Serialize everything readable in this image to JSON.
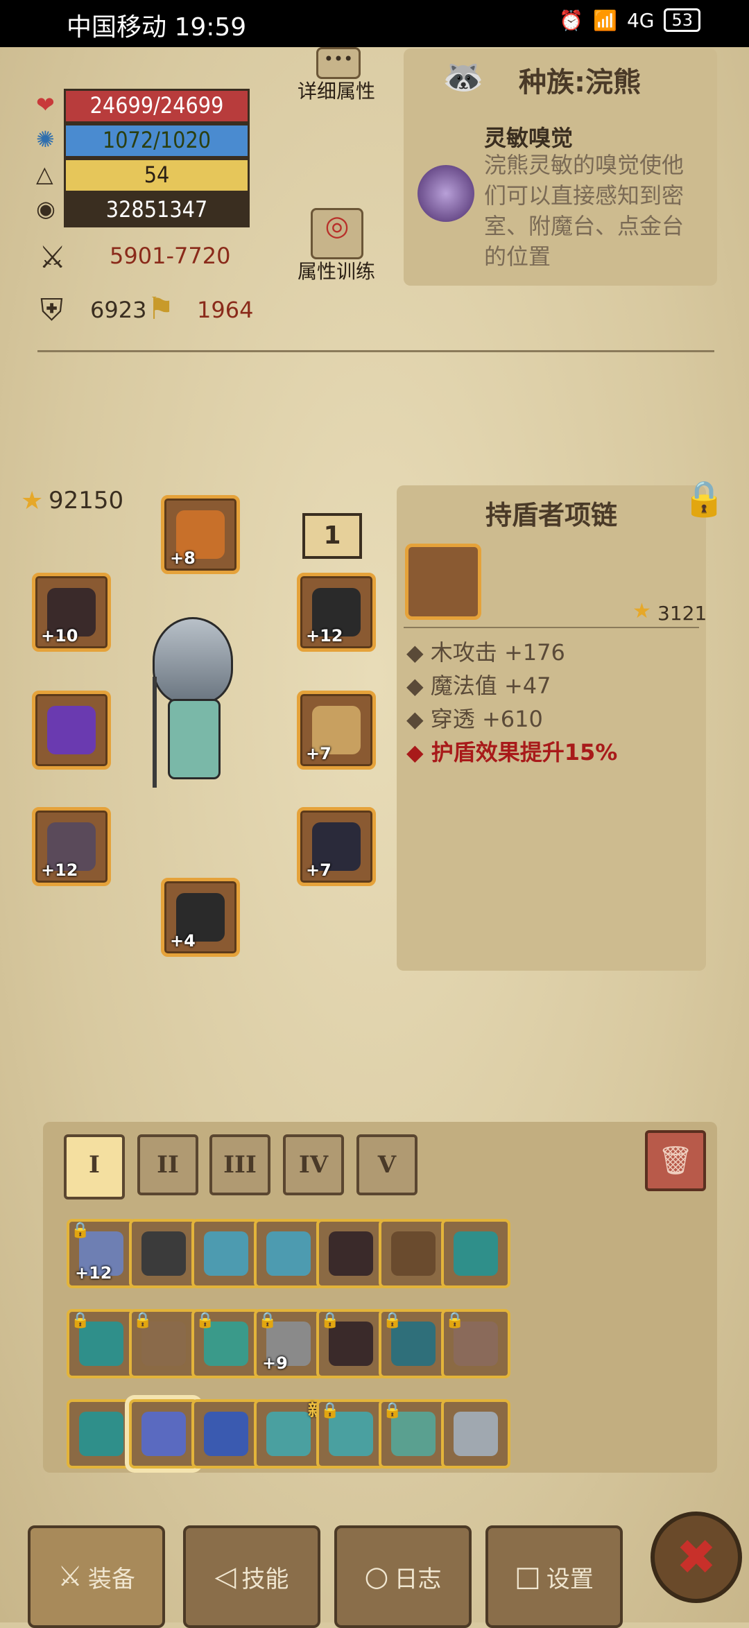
{
  "status_bar": {
    "carrier": "中国移动",
    "time": "19:59",
    "signal": "4G",
    "battery": "53"
  },
  "stats": {
    "hp": "24699/24699",
    "mana": "1072/1020",
    "level": "54",
    "gold": "32851347",
    "attack_range": "5901-7720",
    "defense": "6923",
    "power": "1964"
  },
  "buttons": {
    "details_label": "详细属性",
    "training_label": "属性训练"
  },
  "race": {
    "title": "种族:浣熊",
    "trait_name": "灵敏嗅觉",
    "trait_desc": "浣熊灵敏的嗅觉使他们可以直接感知到密室、附魔台、点金台的位置"
  },
  "score": "92150",
  "set_badge": "1",
  "equipped_slots": [
    {
      "name": "helmet",
      "plus": "+8"
    },
    {
      "name": "cloak",
      "plus": "+10"
    },
    {
      "name": "shoulder",
      "plus": "+12"
    },
    {
      "name": "staff",
      "plus": ""
    },
    {
      "name": "amulet-wings",
      "plus": "+7"
    },
    {
      "name": "bracer",
      "plus": "+12"
    },
    {
      "name": "armor",
      "plus": "+7"
    },
    {
      "name": "boots",
      "plus": "+4"
    }
  ],
  "item_detail": {
    "name": "持盾者项链",
    "score": "3121",
    "stats": [
      "木攻击 +176",
      "魔法值 +47",
      "穿透 +610"
    ],
    "special": "护盾效果提升15%"
  },
  "inventory_tabs": [
    "I",
    "II",
    "III",
    "IV",
    "V"
  ],
  "inventory": [
    {
      "color": "#6e7fb3",
      "locked": true,
      "plus": "+12",
      "badge": ""
    },
    {
      "color": "#3b3b3b",
      "locked": false,
      "plus": "",
      "badge": ""
    },
    {
      "color": "#4d9bb0",
      "locked": false,
      "plus": "",
      "badge": ""
    },
    {
      "color": "#4d9bb0",
      "locked": false,
      "plus": "",
      "badge": ""
    },
    {
      "color": "#3a2a2a",
      "locked": false,
      "plus": "",
      "badge": ""
    },
    {
      "color": "#6a4b2e",
      "locked": false,
      "plus": "",
      "badge": ""
    },
    {
      "color": "#2f8f8a",
      "locked": false,
      "plus": "",
      "badge": ""
    },
    {
      "color": "#2f8f8a",
      "locked": true,
      "plus": "",
      "badge": ""
    },
    {
      "color": "#8a6a4a",
      "locked": true,
      "plus": "",
      "badge": ""
    },
    {
      "color": "#3a9a8a",
      "locked": true,
      "plus": "",
      "badge": ""
    },
    {
      "color": "#8a8a8a",
      "locked": true,
      "plus": "+9",
      "badge": ""
    },
    {
      "color": "#3a2a2a",
      "locked": true,
      "plus": "",
      "badge": ""
    },
    {
      "color": "#2f6f7a",
      "locked": true,
      "plus": "",
      "badge": ""
    },
    {
      "color": "#8a6a5a",
      "locked": true,
      "plus": "",
      "badge": ""
    },
    {
      "color": "#2f8f8a",
      "locked": false,
      "plus": "",
      "badge": ""
    },
    {
      "color": "#5a6ac0",
      "locked": false,
      "plus": "",
      "badge": ""
    },
    {
      "color": "#3a5ab0",
      "locked": false,
      "plus": "",
      "badge": ""
    },
    {
      "color": "#4aa0a0",
      "locked": false,
      "plus": "",
      "badge": "新"
    },
    {
      "color": "#4aa0a0",
      "locked": true,
      "plus": "",
      "badge": ""
    },
    {
      "color": "#5aa090",
      "locked": true,
      "plus": "",
      "badge": ""
    },
    {
      "color": "#a0a8b0",
      "locked": false,
      "plus": "",
      "badge": ""
    }
  ],
  "nav": {
    "equip": "装备",
    "skills": "技能",
    "log": "日志",
    "settings": "设置"
  }
}
